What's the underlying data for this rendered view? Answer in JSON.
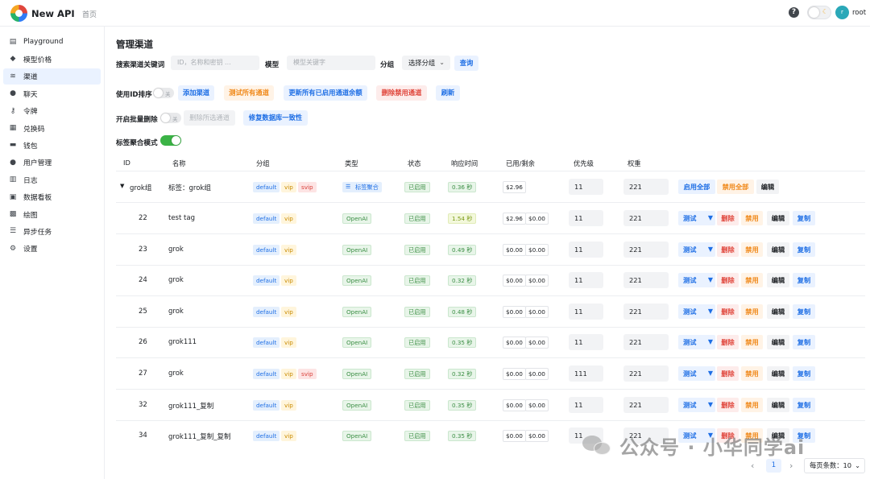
{
  "header": {
    "app_name": "New API",
    "nav_home": "首页",
    "help_glyph": "?",
    "avatar_initial": "r",
    "user_name": "root"
  },
  "sidebar": {
    "items": [
      {
        "label": "Playground",
        "icon": "playground-icon",
        "active": false
      },
      {
        "label": "模型价格",
        "icon": "price-tag-icon",
        "active": false
      },
      {
        "label": "渠道",
        "icon": "layers-icon",
        "active": true
      },
      {
        "label": "聊天",
        "icon": "chat-icon",
        "active": false
      },
      {
        "label": "令牌",
        "icon": "key-icon",
        "active": false
      },
      {
        "label": "兑换码",
        "icon": "gift-icon",
        "active": false
      },
      {
        "label": "钱包",
        "icon": "wallet-icon",
        "active": false
      },
      {
        "label": "用户管理",
        "icon": "user-icon",
        "active": false
      },
      {
        "label": "日志",
        "icon": "log-icon",
        "active": false
      },
      {
        "label": "数据看板",
        "icon": "dashboard-icon",
        "active": false
      },
      {
        "label": "绘图",
        "icon": "image-icon",
        "active": false
      },
      {
        "label": "异步任务",
        "icon": "task-list-icon",
        "active": false
      },
      {
        "label": "设置",
        "icon": "gear-icon",
        "active": false
      }
    ]
  },
  "main": {
    "title": "管理渠道",
    "search": {
      "keyword_label": "搜索渠道关键词",
      "keyword_placeholder": "ID，名称和密钥 ...",
      "model_label": "模型",
      "model_placeholder": "模型关键字",
      "group_label": "分组",
      "group_value": "选择分组",
      "query_button": "查询"
    },
    "toolbar": {
      "sort_by_id_label": "使用ID排序",
      "switch_off": "关",
      "add_channel": "添加渠道",
      "test_all": "测试所有通道",
      "update_balance": "更新所有已启用通道余额",
      "delete_disabled": "删除禁用通道",
      "refresh": "刷新",
      "batch_delete_label": "开启批量删除",
      "delete_selected": "删除所选通道",
      "fix_db": "修复数据库一致性",
      "tag_mode_label": "标签聚合模式"
    },
    "table": {
      "headers": [
        "ID",
        "名称",
        "分组",
        "类型",
        "状态",
        "响应时间",
        "已用/剩余",
        "优先级",
        "权重"
      ],
      "group_row": {
        "id": "grok组",
        "name": "标签：grok组",
        "groups": [
          "default",
          "vip",
          "svip"
        ],
        "type": "标签聚合",
        "status": "已启用",
        "response_time": "0.36 秒",
        "used": "$2.96",
        "priority": "11",
        "weight": "221",
        "enable_all": "启用全部",
        "disable_all": "禁用全部",
        "edit": "编辑"
      },
      "rows": [
        {
          "id": "22",
          "name": "test tag",
          "groups": [
            "default",
            "vip"
          ],
          "type": "OpenAI",
          "status": "已启用",
          "response_time": "1.54 秒",
          "time_warn": true,
          "used": "$2.96",
          "remaining": "$0.00",
          "priority": "11",
          "weight": "221"
        },
        {
          "id": "23",
          "name": "grok",
          "groups": [
            "default",
            "vip"
          ],
          "type": "OpenAI",
          "status": "已启用",
          "response_time": "0.49 秒",
          "time_warn": false,
          "used": "$0.00",
          "remaining": "$0.00",
          "priority": "11",
          "weight": "221"
        },
        {
          "id": "24",
          "name": "grok",
          "groups": [
            "default",
            "vip"
          ],
          "type": "OpenAI",
          "status": "已启用",
          "response_time": "0.32 秒",
          "time_warn": false,
          "used": "$0.00",
          "remaining": "$0.00",
          "priority": "11",
          "weight": "221"
        },
        {
          "id": "25",
          "name": "grok",
          "groups": [
            "default",
            "vip"
          ],
          "type": "OpenAI",
          "status": "已启用",
          "response_time": "0.48 秒",
          "time_warn": false,
          "used": "$0.00",
          "remaining": "$0.00",
          "priority": "11",
          "weight": "221"
        },
        {
          "id": "26",
          "name": "grok111",
          "groups": [
            "default",
            "vip"
          ],
          "type": "OpenAI",
          "status": "已启用",
          "response_time": "0.35 秒",
          "time_warn": false,
          "used": "$0.00",
          "remaining": "$0.00",
          "priority": "11",
          "weight": "221"
        },
        {
          "id": "27",
          "name": "grok",
          "groups": [
            "default",
            "vip",
            "svip"
          ],
          "type": "OpenAI",
          "status": "已启用",
          "response_time": "0.32 秒",
          "time_warn": false,
          "used": "$0.00",
          "remaining": "$0.00",
          "priority": "111",
          "weight": "221"
        },
        {
          "id": "32",
          "name": "grok111_复制",
          "groups": [
            "default",
            "vip"
          ],
          "type": "OpenAI",
          "status": "已启用",
          "response_time": "0.35 秒",
          "time_warn": false,
          "used": "$0.00",
          "remaining": "$0.00",
          "priority": "11",
          "weight": "221"
        },
        {
          "id": "34",
          "name": "grok111_复制_复制",
          "groups": [
            "default",
            "vip"
          ],
          "type": "OpenAI",
          "status": "已启用",
          "response_time": "0.35 秒",
          "time_warn": false,
          "used": "$0.00",
          "remaining": "$0.00",
          "priority": "11",
          "weight": "221"
        }
      ],
      "actions": {
        "test": "测试",
        "delete": "删除",
        "disable": "禁用",
        "edit": "编辑",
        "copy": "复制"
      }
    },
    "pagination": {
      "current_page": "1",
      "page_size_label": "每页条数：10"
    }
  },
  "watermark": {
    "text": "公众号 · 小华同学ai"
  },
  "colors": {
    "accent": "#1f6fe5",
    "success": "#3bb346",
    "warning": "#f08a1c",
    "danger": "#e0463c"
  }
}
